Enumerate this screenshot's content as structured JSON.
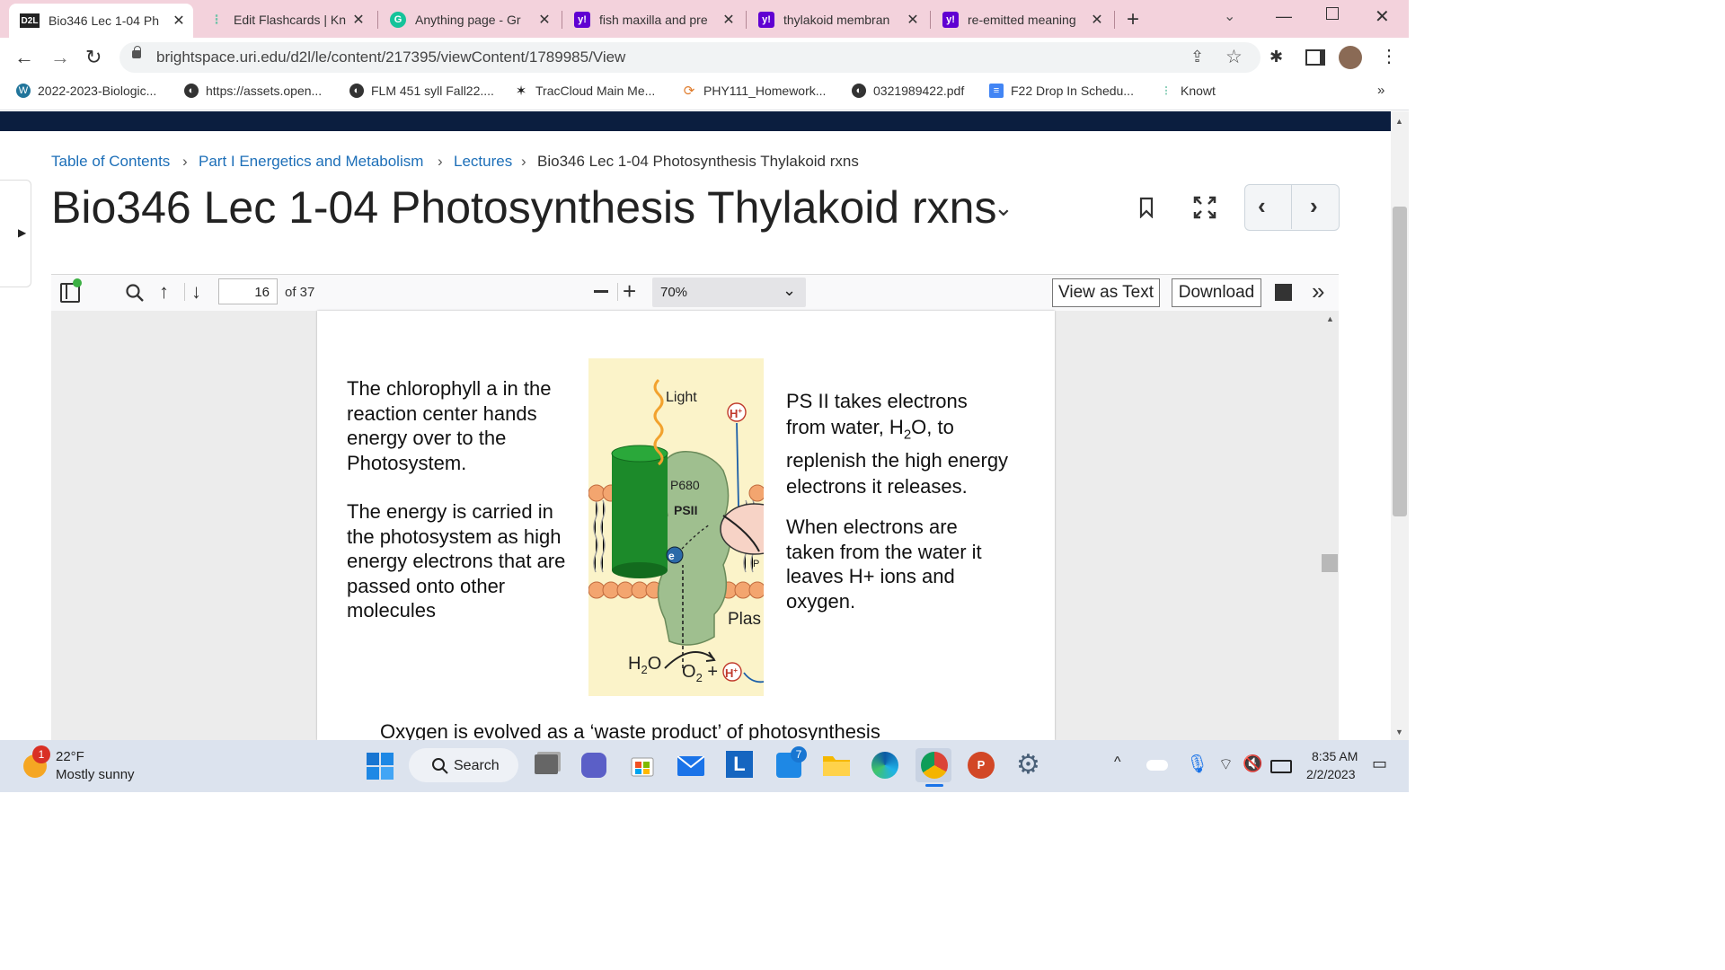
{
  "tabs": [
    {
      "label": "Bio346 Lec 1-04 Ph",
      "favicon": "D2L"
    },
    {
      "label": "Edit Flashcards | Kn",
      "favicon": "knowt-icon"
    },
    {
      "label": "Anything page - Gr",
      "favicon": "G"
    },
    {
      "label": "fish maxilla and pre",
      "favicon": "y!"
    },
    {
      "label": "thylakoid membran",
      "favicon": "y!"
    },
    {
      "label": "re-emitted meaning",
      "favicon": "y!"
    }
  ],
  "address": {
    "url": "brightspace.uri.edu/d2l/le/content/217395/viewContent/1789985/View"
  },
  "bookmarks": [
    {
      "label": "2022-2023-Biologic..."
    },
    {
      "label": "https://assets.open..."
    },
    {
      "label": "FLM 451 syll Fall22...."
    },
    {
      "label": "TracCloud Main Me..."
    },
    {
      "label": "PHY111_Homework..."
    },
    {
      "label": "0321989422.pdf"
    },
    {
      "label": "F22 Drop In Schedu..."
    },
    {
      "label": "Knowt"
    }
  ],
  "bookmarks_more": "»",
  "breadcrumb": [
    {
      "label": "Table of Contents"
    },
    {
      "label": "Part I Energetics and Metabolism"
    },
    {
      "label": "Lectures"
    },
    {
      "label": "Bio346 Lec 1-04 Photosynthesis Thylakoid rxns"
    }
  ],
  "page_title": "Bio346 Lec 1-04 Photosynthesis Thylakoid rxns",
  "pdf_toolbar": {
    "page_value": "16",
    "page_total": "of 37",
    "zoom": "70%",
    "view_as_text": "View as Text",
    "download": "Download",
    "more": "»"
  },
  "slide": {
    "left_para1": [
      "The chlorophyll a in the",
      "reaction center hands",
      "energy over to the",
      "Photosystem."
    ],
    "left_para2": [
      "The energy is carried in",
      "the photosystem as high",
      "energy electrons that are",
      "passed onto other",
      "molecules"
    ],
    "right_para1_l1": "PS II takes electrons",
    "right_para1_l2a": "from water, H",
    "right_para1_l2sub": "2",
    "right_para1_l2b": "O, to",
    "right_para1_l3": "replenish the high energy",
    "right_para1_l4": "electrons it releases.",
    "right_para2": [
      "When electrons are",
      "taken from the water it",
      "leaves H+ ions and",
      "oxygen."
    ],
    "bottom_line": "Oxygen is evolved as a ‘waste product’ of photosynthesis",
    "diagram": {
      "light": "Light",
      "hplus": "H",
      "plus": "+",
      "p680": "P680",
      "psii": "PSII",
      "electron": "e",
      "pq": "P",
      "plast": "Plas",
      "h2o_a": "H",
      "h2o_sub": "2",
      "h2o_b": "O",
      "o2_a": "O",
      "o2_sub": "2",
      "o2_b": " +"
    }
  },
  "taskbar": {
    "weather_badge": "1",
    "temp": "22°F",
    "condition": "Mostly sunny",
    "search": "Search",
    "teams_badge": "7",
    "time": "8:35 AM",
    "date": "2/2/2023"
  }
}
